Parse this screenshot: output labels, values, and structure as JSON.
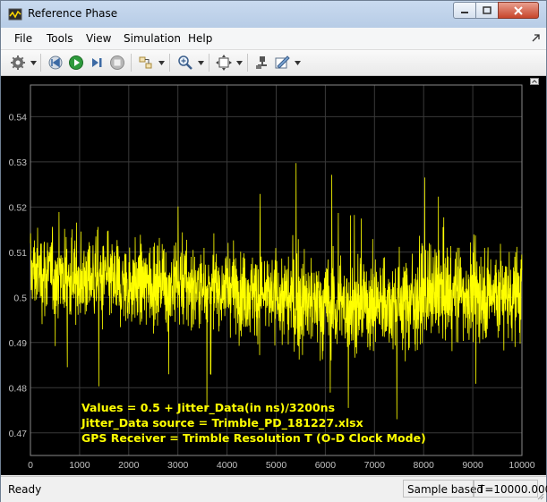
{
  "window": {
    "title": "Reference Phase"
  },
  "menu": {
    "items": [
      "File",
      "Tools",
      "View",
      "Simulation",
      "Help"
    ]
  },
  "toolbar": {
    "icons": [
      "settings-icon",
      "step-back-icon",
      "run-icon",
      "step-forward-icon",
      "stop-icon",
      "signal-select-icon",
      "zoom-icon",
      "fit-to-view-icon",
      "highlight-block-icon",
      "style-icon"
    ]
  },
  "status": {
    "text": "Ready",
    "mode": "Sample based",
    "time": "T=10000.000"
  },
  "colors": {
    "trace": "#ffff00",
    "plot_bg": "#000000",
    "axes_text": "#c0c0c0",
    "grid": "#3a3a3a"
  },
  "chart_data": {
    "type": "line",
    "xlim": [
      0,
      10000
    ],
    "ylim": [
      0.465,
      0.547
    ],
    "xticks": [
      0,
      1000,
      2000,
      3000,
      4000,
      5000,
      6000,
      7000,
      8000,
      9000,
      10000
    ],
    "yticks": [
      0.47,
      0.48,
      0.49,
      0.5,
      0.51,
      0.52,
      0.53,
      0.54
    ],
    "grid": true,
    "annotations": [
      "Values = 0.5 + Jitter_Data(in ns)/3200ns",
      "Jitter_Data source = Trimble_PD_181227.xlsx",
      "GPS Receiver = Trimble Resolution T (O-D Clock Mode)"
    ],
    "series": [
      {
        "x": [
          0,
          500,
          1000,
          1500,
          2000,
          2500,
          3000,
          3500,
          4000,
          4500,
          5000,
          5500,
          6000,
          6500,
          7000,
          7500,
          8000,
          8500,
          9000,
          9500,
          10000
        ],
        "y": [
          0.506,
          0.505,
          0.504,
          0.504,
          0.503,
          0.503,
          0.503,
          0.502,
          0.502,
          0.501,
          0.5,
          0.499,
          0.498,
          0.498,
          0.499,
          0.499,
          0.5,
          0.501,
          0.501,
          0.501,
          0.501
        ],
        "spread": [
          0.006,
          0.006,
          0.006,
          0.006,
          0.006,
          0.006,
          0.006,
          0.006,
          0.006,
          0.006,
          0.007,
          0.007,
          0.007,
          0.007,
          0.007,
          0.007,
          0.007,
          0.007,
          0.007,
          0.007,
          0.007
        ]
      }
    ]
  }
}
